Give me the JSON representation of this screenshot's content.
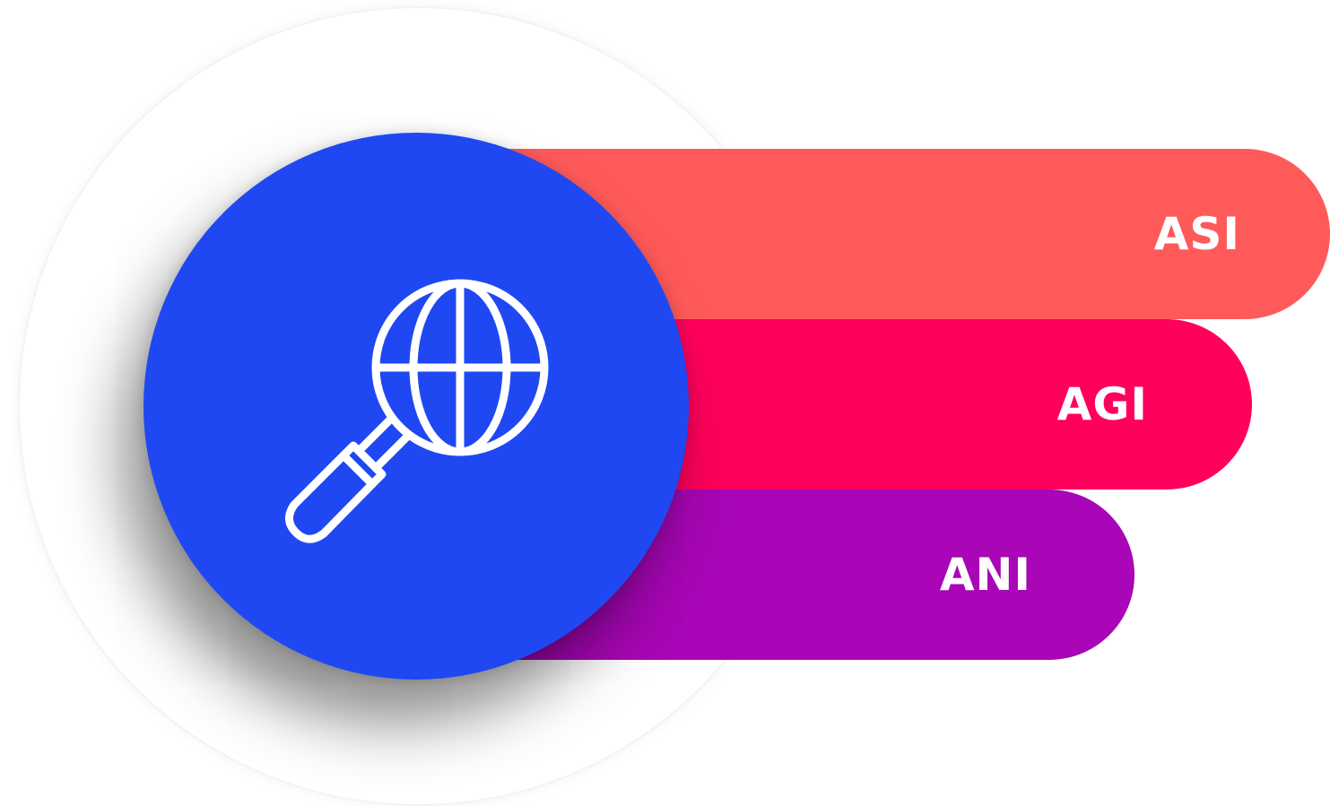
{
  "colors": {
    "circle": "#1F48F3",
    "icon_stroke": "#FFFFFF",
    "text": "#FFFFFF"
  },
  "icon": "globe-search-icon",
  "bars": [
    {
      "label": "ASI",
      "color": "#FF5A5A"
    },
    {
      "label": "AGI",
      "color": "#FF005C"
    },
    {
      "label": "ANI",
      "color": "#A806B6"
    }
  ]
}
